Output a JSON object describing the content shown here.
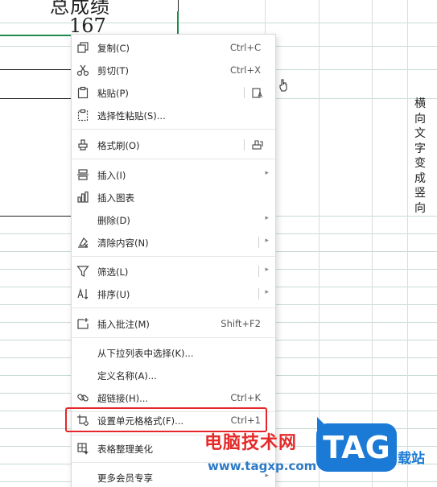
{
  "sheet": {
    "header_cell_text": "总成绩",
    "value_cell": "167",
    "vertical_text_chars": [
      "横",
      "向",
      "文",
      "字",
      "变",
      "成",
      "竖",
      "向"
    ]
  },
  "context_menu": {
    "items": [
      {
        "label": "复制(C)",
        "shortcut": "Ctrl+C",
        "icon": "copy-icon"
      },
      {
        "label": "剪切(T)",
        "shortcut": "Ctrl+X",
        "icon": "scissors-icon"
      },
      {
        "label": "粘贴(P)",
        "shortcut": "",
        "icon": "paste-icon"
      },
      {
        "label": "选择性粘贴(S)...",
        "shortcut": "",
        "icon": "paste-special-icon"
      },
      {
        "label": "格式刷(O)",
        "shortcut": "",
        "icon": "format-brush-icon"
      },
      {
        "label": "插入(I)",
        "shortcut": "",
        "icon": "insert-icon"
      },
      {
        "label": "插入图表",
        "shortcut": "",
        "icon": "chart-icon"
      },
      {
        "label": "删除(D)",
        "shortcut": "",
        "icon": ""
      },
      {
        "label": "清除内容(N)",
        "shortcut": "",
        "icon": "clear-content-icon"
      },
      {
        "label": "筛选(L)",
        "shortcut": "",
        "icon": "filter-icon"
      },
      {
        "label": "排序(U)",
        "shortcut": "",
        "icon": "sort-icon"
      },
      {
        "label": "插入批注(M)",
        "shortcut": "Shift+F2",
        "icon": "comment-icon"
      },
      {
        "label": "从下拉列表中选择(K)...",
        "shortcut": "",
        "icon": ""
      },
      {
        "label": "定义名称(A)...",
        "shortcut": "",
        "icon": ""
      },
      {
        "label": "超链接(H)...",
        "shortcut": "Ctrl+K",
        "icon": "link-icon"
      },
      {
        "label": "设置单元格格式(F)...",
        "shortcut": "Ctrl+1",
        "icon": "cell-format-icon"
      },
      {
        "label": "表格整理美化",
        "shortcut": "",
        "icon": "beautify-icon"
      },
      {
        "label": "更多会员专享",
        "shortcut": "",
        "icon": ""
      }
    ]
  },
  "watermark": {
    "site_name": "电脑技术网",
    "url": "www.tagxp.com",
    "badge": "TAG",
    "side_text": "载站"
  },
  "colors": {
    "selection_border": "#1e8a4a",
    "highlight_box": "#e5262b",
    "watermark_red": "#e52a2a",
    "watermark_blue": "#1a7ad6"
  }
}
